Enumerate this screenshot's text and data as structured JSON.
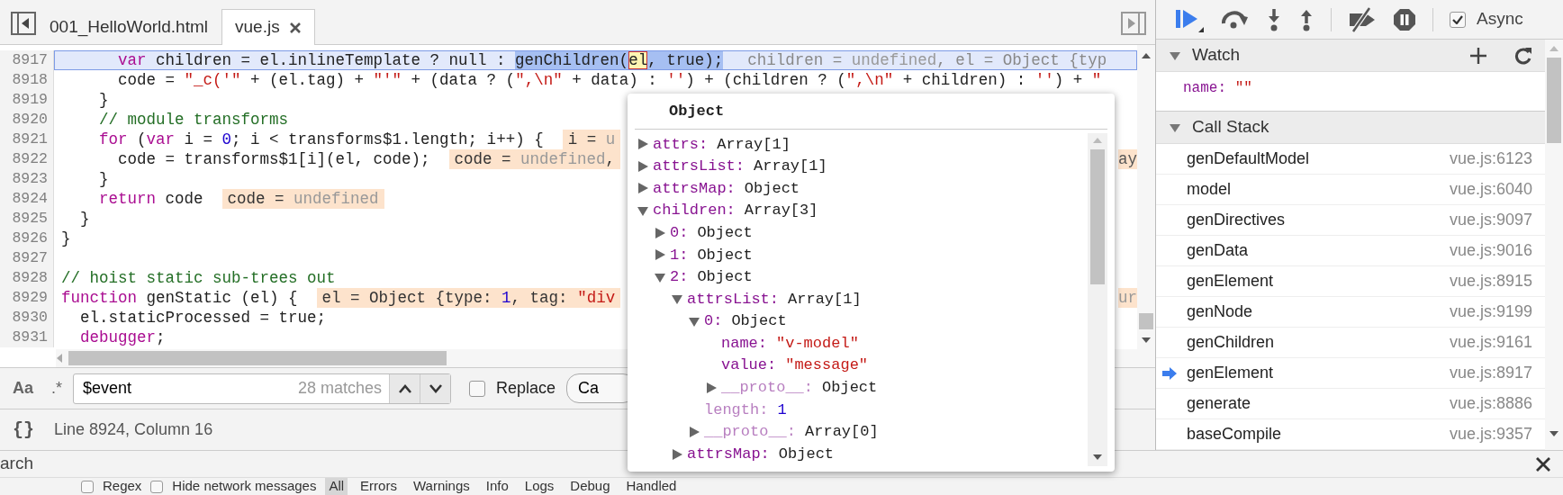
{
  "tabs": [
    {
      "label": "001_HelloWorld.html",
      "selected": false
    },
    {
      "label": "vue.js",
      "selected": true
    }
  ],
  "editor": {
    "lines": [
      {
        "number": "8917",
        "current": true,
        "tokens": [
          {
            "kind": "keyword",
            "text": "      var"
          },
          {
            "kind": "plain",
            "text": " children = el.inlineTemplate ? null : "
          },
          {
            "kind": "selection",
            "text": "genChildren("
          },
          {
            "kind": "hover",
            "text": "el"
          },
          {
            "kind": "selection",
            "text": ", true);"
          }
        ],
        "eval": [
          {
            "kind": "plain",
            "text": "children = "
          },
          {
            "kind": "undefined",
            "text": "undefined"
          },
          {
            "kind": "plain",
            "text": ", el = Object {typ"
          }
        ]
      },
      {
        "number": "8918",
        "current": false,
        "tokens": [
          {
            "kind": "plain",
            "text": "      code = "
          },
          {
            "kind": "string",
            "text": "\"_c('\""
          },
          {
            "kind": "plain",
            "text": " + (el.tag) + "
          },
          {
            "kind": "string",
            "text": "\"'\""
          },
          {
            "kind": "plain",
            "text": " + (data ? ("
          },
          {
            "kind": "string",
            "text": "\",\\n\""
          },
          {
            "kind": "plain",
            "text": " + data) : "
          },
          {
            "kind": "string",
            "text": "''"
          },
          {
            "kind": "plain",
            "text": ") + (children ? ("
          },
          {
            "kind": "string",
            "text": "\",\\n\""
          },
          {
            "kind": "plain",
            "text": " + children) : "
          },
          {
            "kind": "string",
            "text": "''"
          },
          {
            "kind": "plain",
            "text": ") + "
          },
          {
            "kind": "string",
            "text": "\""
          }
        ]
      },
      {
        "number": "8919",
        "current": false,
        "tokens": [
          {
            "kind": "plain",
            "text": "    }"
          }
        ]
      },
      {
        "number": "8920",
        "current": false,
        "tokens": [
          {
            "kind": "comment",
            "text": "    // module transforms"
          }
        ]
      },
      {
        "number": "8921",
        "current": false,
        "tokens": [
          {
            "kind": "keyword",
            "text": "    for"
          },
          {
            "kind": "plain",
            "text": " ("
          },
          {
            "kind": "keyword",
            "text": "var"
          },
          {
            "kind": "plain",
            "text": " i = "
          },
          {
            "kind": "number",
            "text": "0"
          },
          {
            "kind": "plain",
            "text": "; i < transforms$1.length; i++) {"
          }
        ],
        "eval": [
          {
            "kind": "plain",
            "text": "i = "
          },
          {
            "kind": "undefined",
            "text": "u"
          }
        ]
      },
      {
        "number": "8922",
        "current": false,
        "tokens": [
          {
            "kind": "plain",
            "text": "      code = transforms$1[i](el, code);"
          }
        ],
        "eval": [
          {
            "kind": "plain",
            "text": "code = "
          },
          {
            "kind": "undefined",
            "text": "undefined"
          },
          {
            "kind": "plain",
            "text": ","
          }
        ],
        "tail": [
          {
            "kind": "plain",
            "text": "ay"
          }
        ]
      },
      {
        "number": "8923",
        "current": false,
        "tokens": [
          {
            "kind": "plain",
            "text": "    }"
          }
        ]
      },
      {
        "number": "8924",
        "current": false,
        "tokens": [
          {
            "kind": "keyword",
            "text": "    return"
          },
          {
            "kind": "plain",
            "text": " code"
          }
        ],
        "eval": [
          {
            "kind": "plain",
            "text": "code = "
          },
          {
            "kind": "undefined",
            "text": "undefined"
          }
        ]
      },
      {
        "number": "8925",
        "current": false,
        "tokens": [
          {
            "kind": "plain",
            "text": "  }"
          }
        ]
      },
      {
        "number": "8926",
        "current": false,
        "tokens": [
          {
            "kind": "plain",
            "text": "}"
          }
        ]
      },
      {
        "number": "8927",
        "current": false
      },
      {
        "number": "8928",
        "current": false,
        "tokens": [
          {
            "kind": "comment",
            "text": "// hoist static sub-trees out"
          }
        ]
      },
      {
        "number": "8929",
        "current": false,
        "tokens": [
          {
            "kind": "keyword",
            "text": "function"
          },
          {
            "kind": "plain",
            "text": " genStatic (el) {"
          }
        ],
        "eval": [
          {
            "kind": "plain",
            "text": "el = Object {type: "
          },
          {
            "kind": "number",
            "text": "1"
          },
          {
            "kind": "plain",
            "text": ", tag: "
          },
          {
            "kind": "string",
            "text": "\"div"
          }
        ],
        "tail": [
          {
            "kind": "undefined",
            "text": "ur"
          }
        ]
      },
      {
        "number": "8930",
        "current": false,
        "tokens": [
          {
            "kind": "plain",
            "text": "  el.staticProcessed = true;"
          }
        ]
      },
      {
        "number": "8931",
        "current": false,
        "tokens": [
          {
            "kind": "keyword",
            "text": "  debugger"
          },
          {
            "kind": "plain",
            "text": ";"
          }
        ]
      }
    ]
  },
  "search": {
    "case_toggle": "Aa",
    "regex_toggle": ".*",
    "value": "$event",
    "matches": "28 matches",
    "replace": {
      "label": "Replace",
      "checked": false
    },
    "cancel": "Ca"
  },
  "status": {
    "format_button": "{}",
    "position": "Line 8924, Column 16"
  },
  "popover": {
    "title": "Object",
    "nodes": [
      {
        "key": "attrs:",
        "value": "Array[1]",
        "kind": "object",
        "dim": false,
        "expanded": false
      },
      {
        "key": "attrsList:",
        "value": "Array[1]",
        "kind": "object",
        "dim": false,
        "expanded": false
      },
      {
        "key": "attrsMap:",
        "value": "Object",
        "kind": "object",
        "dim": false,
        "expanded": false
      },
      {
        "key": "children:",
        "value": "Array[3]",
        "kind": "object",
        "dim": false,
        "expanded": true,
        "children": [
          {
            "key": "0:",
            "value": "Object",
            "kind": "object",
            "dim": false,
            "expanded": false
          },
          {
            "key": "1:",
            "value": "Object",
            "kind": "object",
            "dim": false,
            "expanded": false
          },
          {
            "key": "2:",
            "value": "Object",
            "kind": "object",
            "dim": false,
            "expanded": true,
            "children": [
              {
                "key": "attrsList:",
                "value": "Array[1]",
                "kind": "object",
                "dim": false,
                "expanded": true,
                "children": [
                  {
                    "key": "0:",
                    "value": "Object",
                    "kind": "object",
                    "dim": false,
                    "expanded": true,
                    "children": [
                      {
                        "key": "name:",
                        "value": "\"v-model\"",
                        "kind": "string",
                        "dim": false
                      },
                      {
                        "key": "value:",
                        "value": "\"message\"",
                        "kind": "string",
                        "dim": false
                      },
                      {
                        "key": "__proto__:",
                        "value": "Object",
                        "kind": "object",
                        "dim": true,
                        "expanded": false
                      }
                    ]
                  },
                  {
                    "key": "length:",
                    "value": "1",
                    "kind": "number",
                    "dim": true
                  },
                  {
                    "key": "__proto__:",
                    "value": "Array[0]",
                    "kind": "object",
                    "dim": true,
                    "expanded": false
                  }
                ]
              },
              {
                "key": "attrsMap:",
                "value": "Object",
                "kind": "object",
                "dim": false,
                "expanded": false
              }
            ]
          }
        ]
      }
    ]
  },
  "debugger": {
    "async": {
      "label": "Async",
      "checked": true
    },
    "watch": {
      "title": "Watch",
      "expanded": true,
      "items": [
        {
          "name": "name:",
          "value": "\"\""
        }
      ]
    },
    "call_stack": {
      "title": "Call Stack",
      "expanded": true,
      "frames": [
        {
          "function": "genDefaultModel",
          "location": "vue.js:6123",
          "selected": false
        },
        {
          "function": "model",
          "location": "vue.js:6040",
          "selected": false
        },
        {
          "function": "genDirectives",
          "location": "vue.js:9097",
          "selected": false
        },
        {
          "function": "genData",
          "location": "vue.js:9016",
          "selected": false
        },
        {
          "function": "genElement",
          "location": "vue.js:8915",
          "selected": false
        },
        {
          "function": "genNode",
          "location": "vue.js:9199",
          "selected": false
        },
        {
          "function": "genChildren",
          "location": "vue.js:9161",
          "selected": false
        },
        {
          "function": "genElement",
          "location": "vue.js:8917",
          "selected": true
        },
        {
          "function": "generate",
          "location": "vue.js:8886",
          "selected": false
        },
        {
          "function": "baseCompile",
          "location": "vue.js:9357",
          "selected": false
        }
      ]
    }
  },
  "drawer": {
    "search": "arch",
    "filters": [
      {
        "kind": "checkbox",
        "label": "Regex",
        "checked": false
      },
      {
        "kind": "checkbox",
        "label": "Hide network messages",
        "checked": false
      },
      {
        "kind": "level",
        "label": "All",
        "selected": true
      },
      {
        "kind": "level",
        "label": "Errors",
        "selected": false
      },
      {
        "kind": "level",
        "label": "Warnings",
        "selected": false
      },
      {
        "kind": "level",
        "label": "Info",
        "selected": false
      },
      {
        "kind": "level",
        "label": "Logs",
        "selected": false
      },
      {
        "kind": "level",
        "label": "Debug",
        "selected": false
      },
      {
        "kind": "level",
        "label": "Handled",
        "selected": false
      }
    ]
  }
}
